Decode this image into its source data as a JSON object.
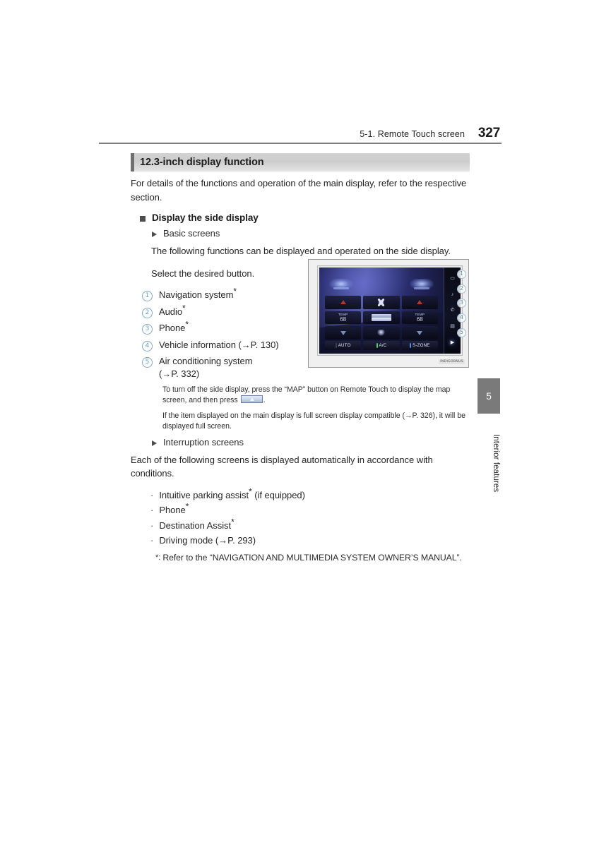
{
  "header": {
    "section": "5-1. Remote Touch screen",
    "page_number": "327"
  },
  "section": {
    "title": "12.3-inch display function"
  },
  "intro": {
    "paragraph": "For details of the functions and operation of the main display, refer to the respective section."
  },
  "display_side_display": {
    "heading": "Display the side display",
    "basic_screens": {
      "label": "Basic screens",
      "paragraph": "The following functions can be displayed and operated on the side display.",
      "select_prompt": "Select the desired button.",
      "items": [
        {
          "num": "1",
          "text": "Navigation system",
          "asterisk": "*"
        },
        {
          "num": "2",
          "text": "Audio",
          "asterisk": "*"
        },
        {
          "num": "3",
          "text": "Phone",
          "asterisk": "*"
        },
        {
          "num": "4",
          "text": "Vehicle information (→P. 130)",
          "asterisk": ""
        },
        {
          "num": "5",
          "text": "Air conditioning system",
          "asterisk": "",
          "text_line2": "(→P. 332)"
        }
      ],
      "notes": [
        {
          "part1": "To turn off the side display, press the “MAP” button on Remote Touch to display the map screen, and then press ",
          "part2": "."
        },
        {
          "part1": "If the item displayed on the main display is full screen display compatible (→P. 326), it will be displayed full screen.",
          "part2": ""
        }
      ]
    },
    "interruption_screens": {
      "label": "Interruption screens",
      "paragraph": "Each of the following screens is displayed automatically in accordance with conditions.",
      "bullet_char": "·",
      "items": [
        {
          "text": "Intuitive parking assist",
          "asterisk": "*",
          "suffix": " (if equipped)"
        },
        {
          "text": "Phone",
          "asterisk": "*",
          "suffix": ""
        },
        {
          "text": "Destination Assist",
          "asterisk": "*",
          "suffix": ""
        },
        {
          "text": "Driving mode (→P. 293)",
          "asterisk": "",
          "suffix": ""
        }
      ]
    }
  },
  "footnote": {
    "mark": "*:",
    "text": "Refer to the “NAVIGATION AND MULTIMEDIA SYSTEM OWNER’S MANUAL”."
  },
  "figure": {
    "caption": "INDIGOBNUS",
    "screen": {
      "temp_left": {
        "label": "TEMP",
        "value": "68"
      },
      "temp_right": {
        "label": "TEMP",
        "value": "68"
      },
      "buttons": [
        {
          "label": "AUTO",
          "led": "led-off"
        },
        {
          "label": "A/C",
          "led": "led-green"
        },
        {
          "label": "S-ZONE",
          "led": "led-blue"
        }
      ],
      "side_icons": [
        "▭",
        "♪",
        "✆",
        "▤",
        "▶"
      ],
      "callouts": [
        "1",
        "2",
        "3",
        "4",
        "5"
      ]
    }
  },
  "thumb_tab": {
    "number": "5",
    "label": "Interior features"
  }
}
